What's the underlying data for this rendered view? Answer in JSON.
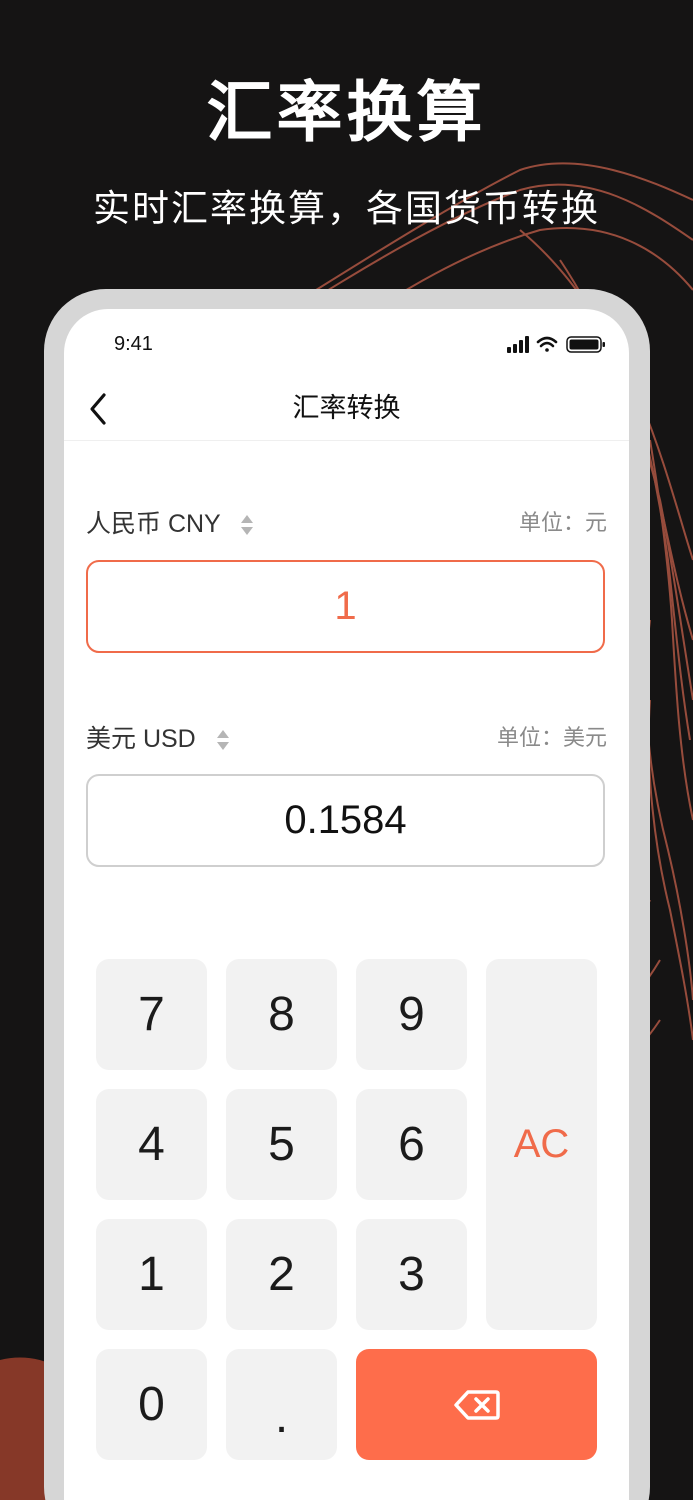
{
  "hero": {
    "title": "汇率换算",
    "subtitle": "实时汇率换算，各国货币转换"
  },
  "status_bar": {
    "time": "9:41",
    "icons": [
      "signal-icon",
      "wifi-icon",
      "battery-icon"
    ]
  },
  "nav": {
    "title": "汇率转换",
    "back_icon": "chevron-left-icon"
  },
  "from_currency": {
    "label": "人民币 CNY",
    "unit": "单位：元",
    "value": "1"
  },
  "to_currency": {
    "label": "美元 USD",
    "unit": "单位：美元",
    "value": "0.1584"
  },
  "keypad": {
    "k7": "7",
    "k8": "8",
    "k9": "9",
    "k4": "4",
    "k5": "5",
    "k6": "6",
    "k1": "1",
    "k2": "2",
    "k3": "3",
    "k0": "0",
    "dot": ".",
    "clear": "AC",
    "delete_icon": "backspace-icon"
  },
  "colors": {
    "accent": "#fe6d4b",
    "background": "#151414",
    "contour_lines": "#c0604c"
  }
}
